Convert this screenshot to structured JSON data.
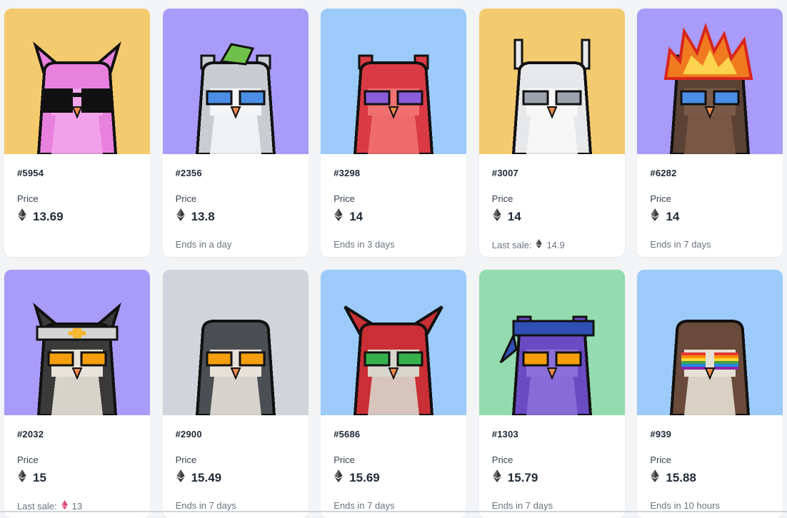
{
  "colors": {
    "yellow": "#f4ca6e",
    "purple": "#a99bfa",
    "blue": "#9ccbfb",
    "gray": "#d1d5db",
    "green": "#94dbaf"
  },
  "price_label": "Price",
  "items": [
    {
      "id": "#5954",
      "price": "13.69",
      "footer": "",
      "bg": "yellow",
      "body": "#e880de",
      "belly": "#f2a4ea",
      "eyes": "shades",
      "head": "none",
      "ears": "tall"
    },
    {
      "id": "#2356",
      "price": "13.8",
      "footer": "Ends in a day",
      "bg": "purple",
      "body": "#c9cdd2",
      "belly": "#f4f5f6",
      "eyes": "blue",
      "head": "leaf",
      "ears": "short"
    },
    {
      "id": "#3298",
      "price": "14",
      "footer": "Ends in 3 days",
      "bg": "blue",
      "body": "#d93a44",
      "belly": "#f07070",
      "eyes": "purple",
      "head": "none",
      "ears": "short"
    },
    {
      "id": "#3007",
      "price": "14",
      "footer_prefix": "Last sale:",
      "footer_value": "14.9",
      "bg": "yellow",
      "body": "#e7e8ea",
      "belly": "#f7f7f8",
      "eyes": "gray",
      "head": "none",
      "ears": "horns"
    },
    {
      "id": "#6282",
      "price": "14",
      "footer": "Ends in 7 days",
      "bg": "purple",
      "body": "#5b4234",
      "belly": "#7a5a46",
      "eyes": "blue",
      "head": "fire",
      "ears": "short"
    },
    {
      "id": "#2032",
      "price": "15",
      "footer_prefix": "Last sale:",
      "footer_value": "13",
      "bg": "purple",
      "body": "#3a3a3a",
      "belly": "#e8e4dc",
      "eyes": "orange",
      "head": "band",
      "ears": "tall"
    },
    {
      "id": "#2900",
      "price": "15.49",
      "footer": "Ends in 7 days",
      "bg": "gray",
      "body": "#4b4e52",
      "belly": "#e6e2da",
      "eyes": "orange",
      "head": "none",
      "ears": "round"
    },
    {
      "id": "#5686",
      "price": "15.69",
      "footer": "Ends in 7 days",
      "bg": "blue",
      "body": "#c92f34",
      "belly": "#d8d6cc",
      "eyes": "green",
      "head": "none",
      "ears": "wide"
    },
    {
      "id": "#1303",
      "price": "15.79",
      "footer": "Ends in 7 days",
      "bg": "green",
      "body": "#6a4bc4",
      "belly": "#8b6fd8",
      "eyes": "orange",
      "head": "bandana",
      "ears": "short"
    },
    {
      "id": "#939",
      "price": "15.88",
      "footer": "Ends in 10 hours",
      "bg": "blue",
      "body": "#6a4a3a",
      "belly": "#e6e0d4",
      "eyes": "rainbow",
      "head": "none",
      "ears": "round"
    }
  ]
}
